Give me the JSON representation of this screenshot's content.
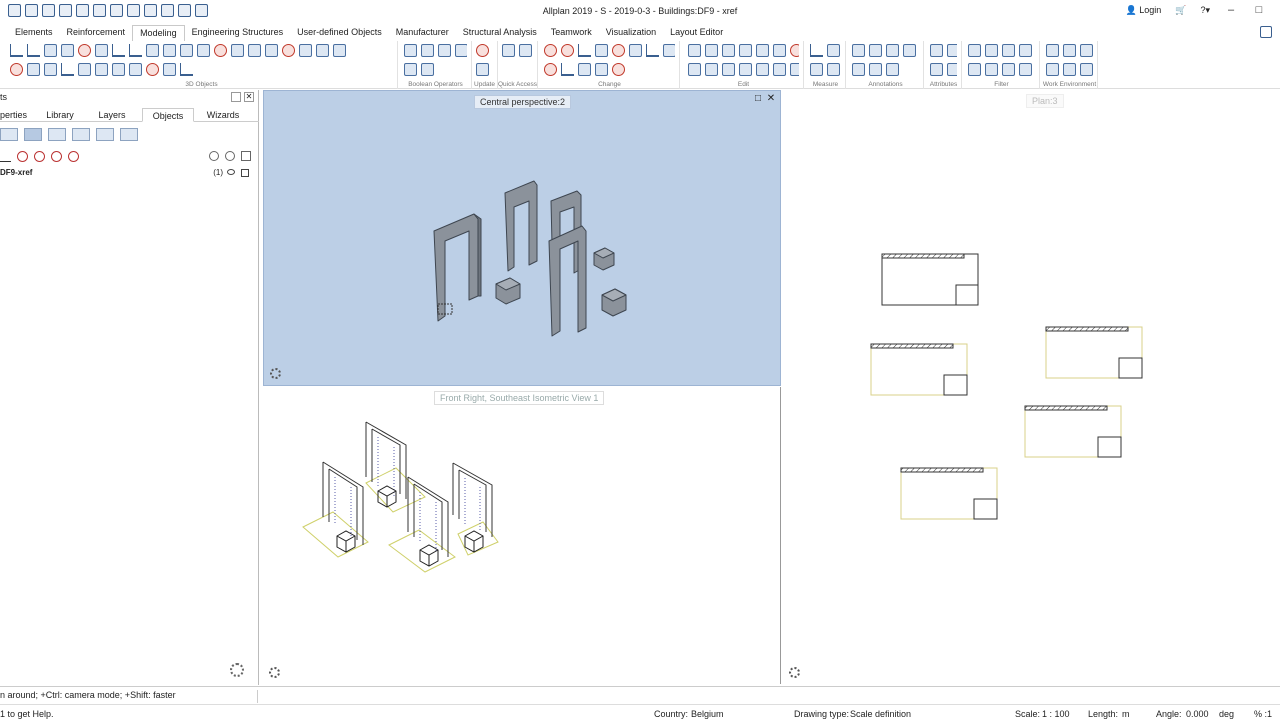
{
  "window": {
    "title": "Allplan 2019 - S - 2019-0-3 - Buildings:DF9 - xref",
    "login_label": "Login",
    "minimize": "–",
    "maximize": "□"
  },
  "menu_tabs": [
    "Elements",
    "Reinforcement",
    "Modeling",
    "Engineering Structures",
    "User-defined Objects",
    "Manufacturer",
    "Structural Analysis",
    "Teamwork",
    "Visualization",
    "Layout Editor"
  ],
  "active_tab": "Modeling",
  "ribbon_groups": [
    "3D Objects",
    "Boolean Operators",
    "Update",
    "Quick Access",
    "Change",
    "Edit",
    "Measure",
    "Annotations",
    "Attributes",
    "Filter",
    "Work Environment"
  ],
  "panel": {
    "title": "ts",
    "tabs": [
      "perties",
      "Library",
      "Layers",
      "Objects",
      "Wizards"
    ],
    "active_tab": "Objects",
    "object_row": {
      "name": "DF9-xref",
      "count": "(1)"
    }
  },
  "viewports": {
    "perspective_label": "Central perspective:2",
    "isometric_label": "Front Right, Southeast Isometric View 1",
    "plan_label": "Plan:3",
    "close_glyph": "✕",
    "restore_glyph": "□"
  },
  "status": {
    "command_hint": "n around; +Ctrl: camera mode; +Shift: faster",
    "help": "1 to get Help.",
    "country_label": "Country:",
    "country_value": "Belgium",
    "drawing_type_label": "Drawing type:",
    "drawing_type_value": "Scale definition",
    "scale_label": "Scale:",
    "scale_value": "1 : 100",
    "length_label": "Length:",
    "length_value": "m",
    "angle_label": "Angle:",
    "angle_value": "0.000",
    "angle_unit": "deg",
    "percent": "% :1"
  },
  "colors": {
    "accent": "#3a5f8f",
    "perspective_bg": "#bccfe6",
    "plan_outline": "#d8d08a"
  }
}
